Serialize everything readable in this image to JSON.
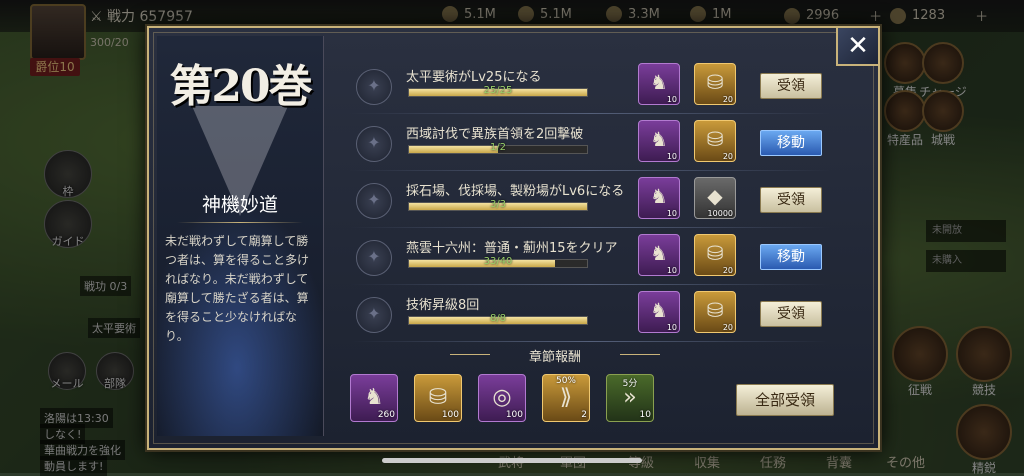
{
  "hud": {
    "player_level": "爵位10",
    "power_label": "戦力",
    "power_value": "657957",
    "hp": "300/20",
    "resources": [
      "5.1M",
      "5.1M",
      "3.3M",
      "1M",
      "2996",
      "1283"
    ],
    "left_buttons": [
      "枠",
      "ガイド",
      "メール",
      "部隊"
    ],
    "battle_merit": "戦功 0/3",
    "quest_label": "太平要術",
    "chat_lines": [
      "洛陽は13:30",
      "しなく!",
      "華曲戦力を強化",
      "動員します!"
    ],
    "right_buttons": [
      "募集",
      "チャージ",
      "特産品",
      "城戦",
      "征戦",
      "競技",
      "精鋭"
    ],
    "right_cards": [
      "未開放",
      "未購入"
    ],
    "bottom_tabs": [
      "武将",
      "軍団",
      "等級",
      "収集",
      "任務",
      "背囊",
      "その他"
    ]
  },
  "chapter": {
    "title": "第20巻",
    "name": "神機妙道",
    "description": "未だ戦わずして廟算して勝つ者は、算を得ること多ければなり。未だ戦わずして廟算して勝たざる者は、算を得ること少なければなり。"
  },
  "quests": [
    {
      "title": "太平要術がLv25になる",
      "progress": "25/25",
      "ratio": 1.0,
      "rewards": [
        {
          "type": "purple",
          "icon": "bronze-beast-icon",
          "count": "10"
        },
        {
          "type": "orange",
          "icon": "gold-ingot-icon",
          "count": "20"
        }
      ],
      "action": "受領",
      "action_type": "claim"
    },
    {
      "title": "西域討伐で異族首領を2回撃破",
      "progress": "1/2",
      "ratio": 0.5,
      "rewards": [
        {
          "type": "purple",
          "icon": "bronze-beast-icon",
          "count": "10"
        },
        {
          "type": "orange",
          "icon": "gold-ingot-icon",
          "count": "20"
        }
      ],
      "action": "移動",
      "action_type": "move"
    },
    {
      "title": "採石場、伐採場、製粉場がLv6になる",
      "progress": "3/3",
      "ratio": 1.0,
      "rewards": [
        {
          "type": "purple",
          "icon": "bronze-beast-icon",
          "count": "10"
        },
        {
          "type": "grey",
          "icon": "iron-ore-icon",
          "count": "10000"
        }
      ],
      "action": "受領",
      "action_type": "claim"
    },
    {
      "title": "燕雲十六州：普通・薊州15をクリア",
      "progress": "33/40",
      "ratio": 0.82,
      "rewards": [
        {
          "type": "purple",
          "icon": "bronze-beast-icon",
          "count": "10"
        },
        {
          "type": "orange",
          "icon": "gold-ingot-icon",
          "count": "20"
        }
      ],
      "action": "移動",
      "action_type": "move"
    },
    {
      "title": "技術昇級8回",
      "progress": "8/8",
      "ratio": 1.0,
      "rewards": [
        {
          "type": "purple",
          "icon": "bronze-beast-icon",
          "count": "10"
        },
        {
          "type": "orange",
          "icon": "gold-ingot-icon",
          "count": "20"
        }
      ],
      "action": "受領",
      "action_type": "claim"
    }
  ],
  "chapter_rewards": {
    "label": "章節報酬",
    "items": [
      {
        "type": "purple",
        "icon": "bronze-beast-icon",
        "count": "260",
        "tag": ""
      },
      {
        "type": "orange",
        "icon": "gold-ingot-icon",
        "count": "100",
        "tag": ""
      },
      {
        "type": "purple",
        "icon": "coin-medal-icon",
        "count": "100",
        "tag": ""
      },
      {
        "type": "orange",
        "icon": "speedup-icon",
        "count": "2",
        "tag": "50%"
      },
      {
        "type": "green",
        "icon": "speedup-arrow-icon",
        "count": "10",
        "tag": "5分"
      }
    ],
    "claim_all": "全部受領"
  },
  "close_label": "✕"
}
